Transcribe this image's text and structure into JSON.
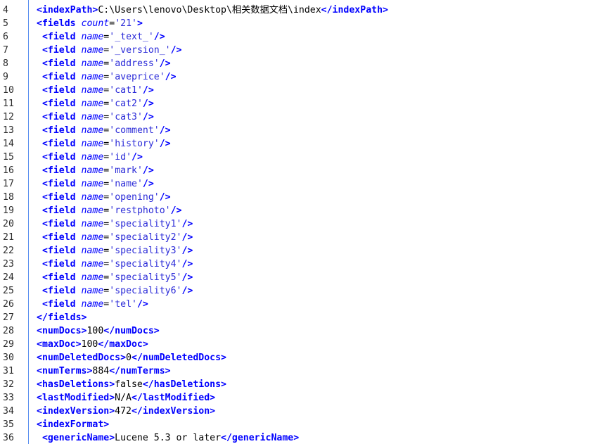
{
  "editor": {
    "colors": {
      "tag": "#0000ff",
      "attribute": "#0000ff",
      "string": "#2b2bd8",
      "text": "#000000",
      "gutter_divider": "#5a8ff0"
    },
    "lines": [
      {
        "num": "4",
        "indent": "",
        "parts": [
          {
            "t": "tag",
            "v": "<indexPath"
          },
          {
            "t": "tag",
            "v": ">"
          },
          {
            "t": "txt",
            "v": "C:\\Users\\lenovo\\Desktop\\相关数据文档\\index"
          },
          {
            "t": "tag",
            "v": "</indexPath>"
          }
        ]
      },
      {
        "num": "5",
        "indent": "",
        "parts": [
          {
            "t": "tag",
            "v": "<fields "
          },
          {
            "t": "attr",
            "v": "count"
          },
          {
            "t": "eq",
            "v": "="
          },
          {
            "t": "str",
            "v": "'21'"
          },
          {
            "t": "tag",
            "v": ">"
          }
        ]
      },
      {
        "num": "6",
        "indent": " ",
        "parts": [
          {
            "t": "tag",
            "v": "<field "
          },
          {
            "t": "attr",
            "v": "name"
          },
          {
            "t": "eq",
            "v": "="
          },
          {
            "t": "str",
            "v": "'_text_'"
          },
          {
            "t": "tag",
            "v": "/>"
          }
        ]
      },
      {
        "num": "7",
        "indent": " ",
        "parts": [
          {
            "t": "tag",
            "v": "<field "
          },
          {
            "t": "attr",
            "v": "name"
          },
          {
            "t": "eq",
            "v": "="
          },
          {
            "t": "str",
            "v": "'_version_'"
          },
          {
            "t": "tag",
            "v": "/>"
          }
        ]
      },
      {
        "num": "8",
        "indent": " ",
        "parts": [
          {
            "t": "tag",
            "v": "<field "
          },
          {
            "t": "attr",
            "v": "name"
          },
          {
            "t": "eq",
            "v": "="
          },
          {
            "t": "str",
            "v": "'address'"
          },
          {
            "t": "tag",
            "v": "/>"
          }
        ]
      },
      {
        "num": "9",
        "indent": " ",
        "parts": [
          {
            "t": "tag",
            "v": "<field "
          },
          {
            "t": "attr",
            "v": "name"
          },
          {
            "t": "eq",
            "v": "="
          },
          {
            "t": "str",
            "v": "'aveprice'"
          },
          {
            "t": "tag",
            "v": "/>"
          }
        ]
      },
      {
        "num": "10",
        "indent": " ",
        "parts": [
          {
            "t": "tag",
            "v": "<field "
          },
          {
            "t": "attr",
            "v": "name"
          },
          {
            "t": "eq",
            "v": "="
          },
          {
            "t": "str",
            "v": "'cat1'"
          },
          {
            "t": "tag",
            "v": "/>"
          }
        ]
      },
      {
        "num": "11",
        "indent": " ",
        "parts": [
          {
            "t": "tag",
            "v": "<field "
          },
          {
            "t": "attr",
            "v": "name"
          },
          {
            "t": "eq",
            "v": "="
          },
          {
            "t": "str",
            "v": "'cat2'"
          },
          {
            "t": "tag",
            "v": "/>"
          }
        ]
      },
      {
        "num": "12",
        "indent": " ",
        "parts": [
          {
            "t": "tag",
            "v": "<field "
          },
          {
            "t": "attr",
            "v": "name"
          },
          {
            "t": "eq",
            "v": "="
          },
          {
            "t": "str",
            "v": "'cat3'"
          },
          {
            "t": "tag",
            "v": "/>"
          }
        ]
      },
      {
        "num": "13",
        "indent": " ",
        "parts": [
          {
            "t": "tag",
            "v": "<field "
          },
          {
            "t": "attr",
            "v": "name"
          },
          {
            "t": "eq",
            "v": "="
          },
          {
            "t": "str",
            "v": "'comment'"
          },
          {
            "t": "tag",
            "v": "/>"
          }
        ]
      },
      {
        "num": "14",
        "indent": " ",
        "parts": [
          {
            "t": "tag",
            "v": "<field "
          },
          {
            "t": "attr",
            "v": "name"
          },
          {
            "t": "eq",
            "v": "="
          },
          {
            "t": "str",
            "v": "'history'"
          },
          {
            "t": "tag",
            "v": "/>"
          }
        ]
      },
      {
        "num": "15",
        "indent": " ",
        "parts": [
          {
            "t": "tag",
            "v": "<field "
          },
          {
            "t": "attr",
            "v": "name"
          },
          {
            "t": "eq",
            "v": "="
          },
          {
            "t": "str",
            "v": "'id'"
          },
          {
            "t": "tag",
            "v": "/>"
          }
        ]
      },
      {
        "num": "16",
        "indent": " ",
        "parts": [
          {
            "t": "tag",
            "v": "<field "
          },
          {
            "t": "attr",
            "v": "name"
          },
          {
            "t": "eq",
            "v": "="
          },
          {
            "t": "str",
            "v": "'mark'"
          },
          {
            "t": "tag",
            "v": "/>"
          }
        ]
      },
      {
        "num": "17",
        "indent": " ",
        "parts": [
          {
            "t": "tag",
            "v": "<field "
          },
          {
            "t": "attr",
            "v": "name"
          },
          {
            "t": "eq",
            "v": "="
          },
          {
            "t": "str",
            "v": "'name'"
          },
          {
            "t": "tag",
            "v": "/>"
          }
        ]
      },
      {
        "num": "18",
        "indent": " ",
        "parts": [
          {
            "t": "tag",
            "v": "<field "
          },
          {
            "t": "attr",
            "v": "name"
          },
          {
            "t": "eq",
            "v": "="
          },
          {
            "t": "str",
            "v": "'opening'"
          },
          {
            "t": "tag",
            "v": "/>"
          }
        ]
      },
      {
        "num": "19",
        "indent": " ",
        "parts": [
          {
            "t": "tag",
            "v": "<field "
          },
          {
            "t": "attr",
            "v": "name"
          },
          {
            "t": "eq",
            "v": "="
          },
          {
            "t": "str",
            "v": "'restphoto'"
          },
          {
            "t": "tag",
            "v": "/>"
          }
        ]
      },
      {
        "num": "20",
        "indent": " ",
        "parts": [
          {
            "t": "tag",
            "v": "<field "
          },
          {
            "t": "attr",
            "v": "name"
          },
          {
            "t": "eq",
            "v": "="
          },
          {
            "t": "str",
            "v": "'speciality1'"
          },
          {
            "t": "tag",
            "v": "/>"
          }
        ]
      },
      {
        "num": "21",
        "indent": " ",
        "parts": [
          {
            "t": "tag",
            "v": "<field "
          },
          {
            "t": "attr",
            "v": "name"
          },
          {
            "t": "eq",
            "v": "="
          },
          {
            "t": "str",
            "v": "'speciality2'"
          },
          {
            "t": "tag",
            "v": "/>"
          }
        ]
      },
      {
        "num": "22",
        "indent": " ",
        "parts": [
          {
            "t": "tag",
            "v": "<field "
          },
          {
            "t": "attr",
            "v": "name"
          },
          {
            "t": "eq",
            "v": "="
          },
          {
            "t": "str",
            "v": "'speciality3'"
          },
          {
            "t": "tag",
            "v": "/>"
          }
        ]
      },
      {
        "num": "23",
        "indent": " ",
        "parts": [
          {
            "t": "tag",
            "v": "<field "
          },
          {
            "t": "attr",
            "v": "name"
          },
          {
            "t": "eq",
            "v": "="
          },
          {
            "t": "str",
            "v": "'speciality4'"
          },
          {
            "t": "tag",
            "v": "/>"
          }
        ]
      },
      {
        "num": "24",
        "indent": " ",
        "parts": [
          {
            "t": "tag",
            "v": "<field "
          },
          {
            "t": "attr",
            "v": "name"
          },
          {
            "t": "eq",
            "v": "="
          },
          {
            "t": "str",
            "v": "'speciality5'"
          },
          {
            "t": "tag",
            "v": "/>"
          }
        ]
      },
      {
        "num": "25",
        "indent": " ",
        "parts": [
          {
            "t": "tag",
            "v": "<field "
          },
          {
            "t": "attr",
            "v": "name"
          },
          {
            "t": "eq",
            "v": "="
          },
          {
            "t": "str",
            "v": "'speciality6'"
          },
          {
            "t": "tag",
            "v": "/>"
          }
        ]
      },
      {
        "num": "26",
        "indent": " ",
        "parts": [
          {
            "t": "tag",
            "v": "<field "
          },
          {
            "t": "attr",
            "v": "name"
          },
          {
            "t": "eq",
            "v": "="
          },
          {
            "t": "str",
            "v": "'tel'"
          },
          {
            "t": "tag",
            "v": "/>"
          }
        ]
      },
      {
        "num": "27",
        "indent": "",
        "parts": [
          {
            "t": "tag",
            "v": "</fields>"
          }
        ]
      },
      {
        "num": "28",
        "indent": "",
        "parts": [
          {
            "t": "tag",
            "v": "<numDocs>"
          },
          {
            "t": "txt",
            "v": "100"
          },
          {
            "t": "tag",
            "v": "</numDocs>"
          }
        ]
      },
      {
        "num": "29",
        "indent": "",
        "parts": [
          {
            "t": "tag",
            "v": "<maxDoc>"
          },
          {
            "t": "txt",
            "v": "100"
          },
          {
            "t": "tag",
            "v": "</maxDoc>"
          }
        ]
      },
      {
        "num": "30",
        "indent": "",
        "parts": [
          {
            "t": "tag",
            "v": "<numDeletedDocs>"
          },
          {
            "t": "txt",
            "v": "0"
          },
          {
            "t": "tag",
            "v": "</numDeletedDocs>"
          }
        ]
      },
      {
        "num": "31",
        "indent": "",
        "parts": [
          {
            "t": "tag",
            "v": "<numTerms>"
          },
          {
            "t": "txt",
            "v": "884"
          },
          {
            "t": "tag",
            "v": "</numTerms>"
          }
        ]
      },
      {
        "num": "32",
        "indent": "",
        "parts": [
          {
            "t": "tag",
            "v": "<hasDeletions>"
          },
          {
            "t": "txt",
            "v": "false"
          },
          {
            "t": "tag",
            "v": "</hasDeletions>"
          }
        ]
      },
      {
        "num": "33",
        "indent": "",
        "parts": [
          {
            "t": "tag",
            "v": "<lastModified>"
          },
          {
            "t": "txt",
            "v": "N/A"
          },
          {
            "t": "tag",
            "v": "</lastModified>"
          }
        ]
      },
      {
        "num": "34",
        "indent": "",
        "parts": [
          {
            "t": "tag",
            "v": "<indexVersion>"
          },
          {
            "t": "txt",
            "v": "472"
          },
          {
            "t": "tag",
            "v": "</indexVersion>"
          }
        ]
      },
      {
        "num": "35",
        "indent": "",
        "parts": [
          {
            "t": "tag",
            "v": "<indexFormat>"
          }
        ]
      },
      {
        "num": "36",
        "indent": " ",
        "parts": [
          {
            "t": "tag",
            "v": "<genericName>"
          },
          {
            "t": "txt",
            "v": "Lucene 5.3 or later"
          },
          {
            "t": "tag",
            "v": "</genericName>"
          }
        ]
      }
    ]
  }
}
